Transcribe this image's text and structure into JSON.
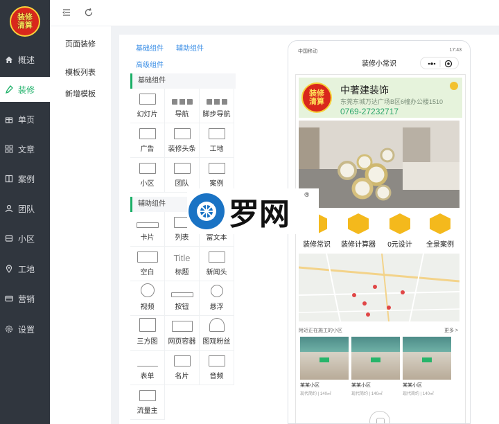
{
  "nav": {
    "logo_top": "装修",
    "logo_bottom": "清算",
    "items": [
      {
        "label": "概述",
        "icon": "home-icon"
      },
      {
        "label": "装修",
        "icon": "brush-icon"
      },
      {
        "label": "单页",
        "icon": "gift-icon"
      },
      {
        "label": "文章",
        "icon": "grid-icon"
      },
      {
        "label": "案例",
        "icon": "book-icon"
      },
      {
        "label": "团队",
        "icon": "user-icon"
      },
      {
        "label": "小区",
        "icon": "box-icon"
      },
      {
        "label": "工地",
        "icon": "location-icon"
      },
      {
        "label": "营销",
        "icon": "card-icon"
      },
      {
        "label": "设置",
        "icon": "gear-icon"
      }
    ],
    "active_color": "#1aaf66"
  },
  "subnav": {
    "items": [
      "页面装修",
      "模板列表",
      "新增模板"
    ]
  },
  "components": {
    "tabs": [
      "基础组件",
      "辅助组件",
      "高级组件"
    ],
    "basic_title": "基础组件",
    "basic": [
      "幻灯片",
      "导航",
      "脚步导航",
      "广告",
      "装修头条",
      "工地",
      "小区",
      "团队",
      "案例"
    ],
    "aux_title": "辅助组件",
    "aux": [
      "卡片",
      "列表",
      "富文本",
      "空白",
      "标题",
      "新闻头",
      "视频",
      "按钮",
      "悬浮",
      "三方图",
      "网页容器",
      "图观粉丝",
      "表单",
      "名片",
      "音频",
      "流量主"
    ],
    "title_icon_text": "Title"
  },
  "phone": {
    "carrier": "中国移动",
    "status_right": "17:43",
    "title": "装修小常识",
    "company": "中著建装饰",
    "address": "东莞东城万达广场B区6幢办公楼1510",
    "phone": "0769-27232717",
    "features": [
      "装修常识",
      "装修计算器",
      "0元设计",
      "全景案例"
    ],
    "nearby_title": "附近正在施工的小区",
    "more": "更多 >",
    "cards": [
      {
        "name": "某某小区",
        "info": "现代简约 | 140㎡"
      },
      {
        "name": "某某小区",
        "info": "现代简约 | 140㎡"
      },
      {
        "name": "某某小区",
        "info": "现代简约 | 140㎡"
      }
    ]
  },
  "watermark": {
    "text": "罗网",
    "reg": "®"
  }
}
